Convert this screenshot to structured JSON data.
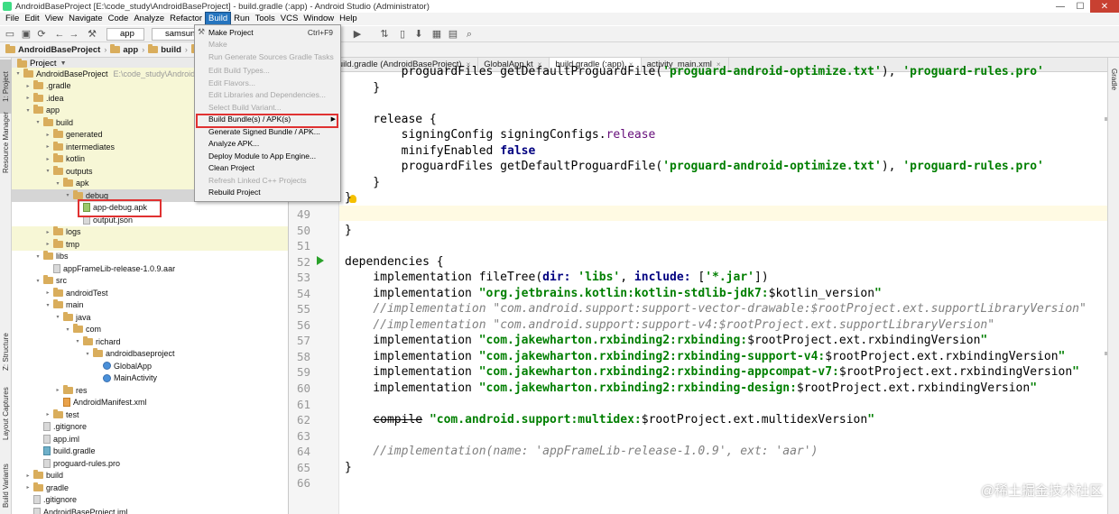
{
  "window": {
    "title": "AndroidBaseProject [E:\\code_study\\AndroidBaseProject] - build.gradle (:app) - Android Studio (Administrator)",
    "controls": [
      "—",
      "☐",
      "✕"
    ]
  },
  "menubar": {
    "items": [
      "File",
      "Edit",
      "View",
      "Navigate",
      "Code",
      "Analyze",
      "Refactor",
      "Build",
      "Run",
      "Tools",
      "VCS",
      "Window",
      "Help"
    ],
    "active": "Build"
  },
  "toolbar": {
    "run_config": "app",
    "device": "samsung"
  },
  "breadcrumb": {
    "items": [
      "AndroidBaseProject",
      "app",
      "build",
      "outpu"
    ]
  },
  "left_tabs": [
    "1: Project",
    "Resource Manager",
    "Z: Structure",
    "Layout Captures",
    "Build Variants"
  ],
  "right_tabs": [
    "Gradle"
  ],
  "project_panel": {
    "title": "Project",
    "tree": [
      {
        "label": "AndroidBaseProject",
        "extra": "E:\\code_study\\AndroidBa",
        "type": "folder",
        "indent": 0,
        "arrow": "▾"
      },
      {
        "label": ".gradle",
        "type": "folder",
        "indent": 1,
        "arrow": "▸"
      },
      {
        "label": ".idea",
        "type": "folder",
        "indent": 1,
        "arrow": "▸"
      },
      {
        "label": "app",
        "type": "folder",
        "indent": 1,
        "arrow": "▾"
      },
      {
        "label": "build",
        "type": "folder",
        "indent": 2,
        "arrow": "▾"
      },
      {
        "label": "generated",
        "type": "folder",
        "indent": 3,
        "arrow": "▸"
      },
      {
        "label": "intermediates",
        "type": "folder",
        "indent": 3,
        "arrow": "▸"
      },
      {
        "label": "kotlin",
        "type": "folder",
        "indent": 3,
        "arrow": "▸"
      },
      {
        "label": "outputs",
        "type": "folder",
        "indent": 3,
        "arrow": "▾"
      },
      {
        "label": "apk",
        "type": "folder",
        "indent": 4,
        "arrow": "▾"
      },
      {
        "label": "debug",
        "type": "folder",
        "indent": 5,
        "arrow": "▾"
      },
      {
        "label": "app-debug.apk",
        "type": "apk",
        "indent": 6,
        "arrow": ""
      },
      {
        "label": "output.json",
        "type": "file",
        "indent": 6,
        "arrow": ""
      },
      {
        "label": "logs",
        "type": "folder",
        "indent": 3,
        "arrow": "▸"
      },
      {
        "label": "tmp",
        "type": "folder",
        "indent": 3,
        "arrow": "▸"
      },
      {
        "label": "libs",
        "type": "folder",
        "indent": 2,
        "arrow": "▾"
      },
      {
        "label": "appFrameLib-release-1.0.9.aar",
        "type": "file",
        "indent": 3,
        "arrow": ""
      },
      {
        "label": "src",
        "type": "folder",
        "indent": 2,
        "arrow": "▾"
      },
      {
        "label": "androidTest",
        "type": "folder",
        "indent": 3,
        "arrow": "▸"
      },
      {
        "label": "main",
        "type": "folder",
        "indent": 3,
        "arrow": "▾"
      },
      {
        "label": "java",
        "type": "folder",
        "indent": 4,
        "arrow": "▾"
      },
      {
        "label": "com",
        "type": "folder",
        "indent": 5,
        "arrow": "▾"
      },
      {
        "label": "richard",
        "type": "folder",
        "indent": 6,
        "arrow": "▾"
      },
      {
        "label": "androidbaseproject",
        "type": "folder",
        "indent": 7,
        "arrow": "▾"
      },
      {
        "label": "GlobalApp",
        "type": "class",
        "indent": 8,
        "arrow": ""
      },
      {
        "label": "MainActivity",
        "type": "class",
        "indent": 8,
        "arrow": ""
      },
      {
        "label": "res",
        "type": "folder",
        "indent": 4,
        "arrow": "▸"
      },
      {
        "label": "AndroidManifest.xml",
        "type": "xml",
        "indent": 4,
        "arrow": ""
      },
      {
        "label": "test",
        "type": "folder",
        "indent": 3,
        "arrow": "▸"
      },
      {
        "label": ".gitignore",
        "type": "file",
        "indent": 2,
        "arrow": ""
      },
      {
        "label": "app.iml",
        "type": "file",
        "indent": 2,
        "arrow": ""
      },
      {
        "label": "build.gradle",
        "type": "gradle",
        "indent": 2,
        "arrow": ""
      },
      {
        "label": "proguard-rules.pro",
        "type": "file",
        "indent": 2,
        "arrow": ""
      },
      {
        "label": "build",
        "type": "folder",
        "indent": 1,
        "arrow": "▸"
      },
      {
        "label": "gradle",
        "type": "folder",
        "indent": 1,
        "arrow": "▸"
      },
      {
        "label": ".gitignore",
        "type": "file",
        "indent": 1,
        "arrow": ""
      },
      {
        "label": "AndroidBaseProject.iml",
        "type": "file",
        "indent": 1,
        "arrow": ""
      }
    ]
  },
  "editor_tabs": [
    {
      "label": "ity.kt",
      "active": false
    },
    {
      "label": "build.gradle (AndroidBaseProject)",
      "active": false
    },
    {
      "label": "GlobalApp.kt",
      "active": false
    },
    {
      "label": "build.gradle (:app)",
      "active": true
    },
    {
      "label": "activity_main.xml",
      "active": false
    }
  ],
  "build_menu": {
    "items": [
      {
        "label": "Make Project",
        "shortcut": "Ctrl+F9",
        "disabled": false,
        "submenu": false
      },
      {
        "label": "Make",
        "shortcut": "",
        "disabled": true,
        "submenu": false
      },
      {
        "label": "Run Generate Sources Gradle Tasks",
        "shortcut": "",
        "disabled": true,
        "submenu": false
      },
      {
        "label": "Edit Build Types...",
        "shortcut": "",
        "disabled": true,
        "submenu": false
      },
      {
        "label": "Edit Flavors...",
        "shortcut": "",
        "disabled": true,
        "submenu": false
      },
      {
        "label": "Edit Libraries and Dependencies...",
        "shortcut": "",
        "disabled": true,
        "submenu": false
      },
      {
        "label": "Select Build Variant...",
        "shortcut": "",
        "disabled": true,
        "submenu": false
      },
      {
        "label": "Build Bundle(s) / APK(s)",
        "shortcut": "",
        "disabled": false,
        "submenu": true
      },
      {
        "label": "Generate Signed Bundle / APK...",
        "shortcut": "",
        "disabled": false,
        "submenu": false
      },
      {
        "label": "Analyze APK...",
        "shortcut": "",
        "disabled": false,
        "submenu": false
      },
      {
        "label": "Deploy Module to App Engine...",
        "shortcut": "",
        "disabled": false,
        "submenu": false
      },
      {
        "label": "Clean Project",
        "shortcut": "",
        "disabled": false,
        "submenu": false
      },
      {
        "label": "Refresh Linked C++ Projects",
        "shortcut": "",
        "disabled": true,
        "submenu": false
      },
      {
        "label": "Rebuild Project",
        "shortcut": "",
        "disabled": false,
        "submenu": false
      }
    ]
  },
  "code": {
    "lines": [
      {
        "num": "",
        "html": "        proguardFiles getDefaultProguardFile(<span class='str'>'proguard-android-optimize.txt'</span>), <span class='str'>'proguard-rules.pro'</span>"
      },
      {
        "num": "",
        "html": "    }"
      },
      {
        "num": "",
        "html": ""
      },
      {
        "num": "",
        "html": "    release {"
      },
      {
        "num": "",
        "html": "        signingConfig signingConfigs.<span class='prop'>release</span>"
      },
      {
        "num": "",
        "html": "        minifyEnabled <span class='kw'>false</span>"
      },
      {
        "num": "",
        "html": "        proguardFiles getDefaultProguardFile(<span class='str'>'proguard-android-optimize.txt'</span>), <span class='str'>'proguard-rules.pro'</span>"
      },
      {
        "num": "",
        "html": "    }"
      },
      {
        "num": "",
        "html": "}"
      },
      {
        "num": "49",
        "html": ""
      },
      {
        "num": "50",
        "html": "}"
      },
      {
        "num": "51",
        "html": ""
      },
      {
        "num": "52",
        "html": "dependencies {"
      },
      {
        "num": "53",
        "html": "    implementation fileTree(<span class='kw'>dir: </span><span class='str'>'libs'</span>, <span class='kw'>include: </span>[<span class='str'>'*.jar'</span>])"
      },
      {
        "num": "54",
        "html": "    implementation <span class='str'>\"org.jetbrains.kotlin:kotlin-stdlib-jdk7:</span>$kotlin_version<span class='str'>\"</span>"
      },
      {
        "num": "55",
        "html": "    <span class='cmt'>//implementation \"com.android.support:support-vector-drawable:$rootProject.ext.supportLibraryVersion\"</span>"
      },
      {
        "num": "56",
        "html": "    <span class='cmt'>//implementation \"com.android.support:support-v4:$rootProject.ext.supportLibraryVersion\"</span>"
      },
      {
        "num": "57",
        "html": "    implementation <span class='str'>\"com.jakewharton.rxbinding2:rxbinding:</span>$rootProject.ext.rxbindingVersion<span class='str'>\"</span>"
      },
      {
        "num": "58",
        "html": "    implementation <span class='str'>\"com.jakewharton.rxbinding2:rxbinding-support-v4:</span>$rootProject.ext.rxbindingVersion<span class='str'>\"</span>"
      },
      {
        "num": "59",
        "html": "    implementation <span class='str'>\"com.jakewharton.rxbinding2:rxbinding-appcompat-v7:</span>$rootProject.ext.rxbindingVersion<span class='str'>\"</span>"
      },
      {
        "num": "60",
        "html": "    implementation <span class='str'>\"com.jakewharton.rxbinding2:rxbinding-design:</span>$rootProject.ext.rxbindingVersion<span class='str'>\"</span>"
      },
      {
        "num": "61",
        "html": ""
      },
      {
        "num": "62",
        "html": "    <span class='strike'>compile</span> <span class='str'>\"com.android.support:multidex:</span>$rootProject.ext.multidexVersion<span class='str'>\"</span>"
      },
      {
        "num": "63",
        "html": ""
      },
      {
        "num": "64",
        "html": "    <span class='cmt'>//implementation(name: 'appFrameLib-release-1.0.9', ext: 'aar')</span>"
      },
      {
        "num": "65",
        "html": "}"
      },
      {
        "num": "66",
        "html": ""
      }
    ]
  },
  "watermark": "@稀土掘金技术社区",
  "colors": {
    "highlight_box": "#e03131",
    "menu_active": "#2675bf",
    "string": "#007f00",
    "keyword": "#000080",
    "comment": "#808080"
  }
}
